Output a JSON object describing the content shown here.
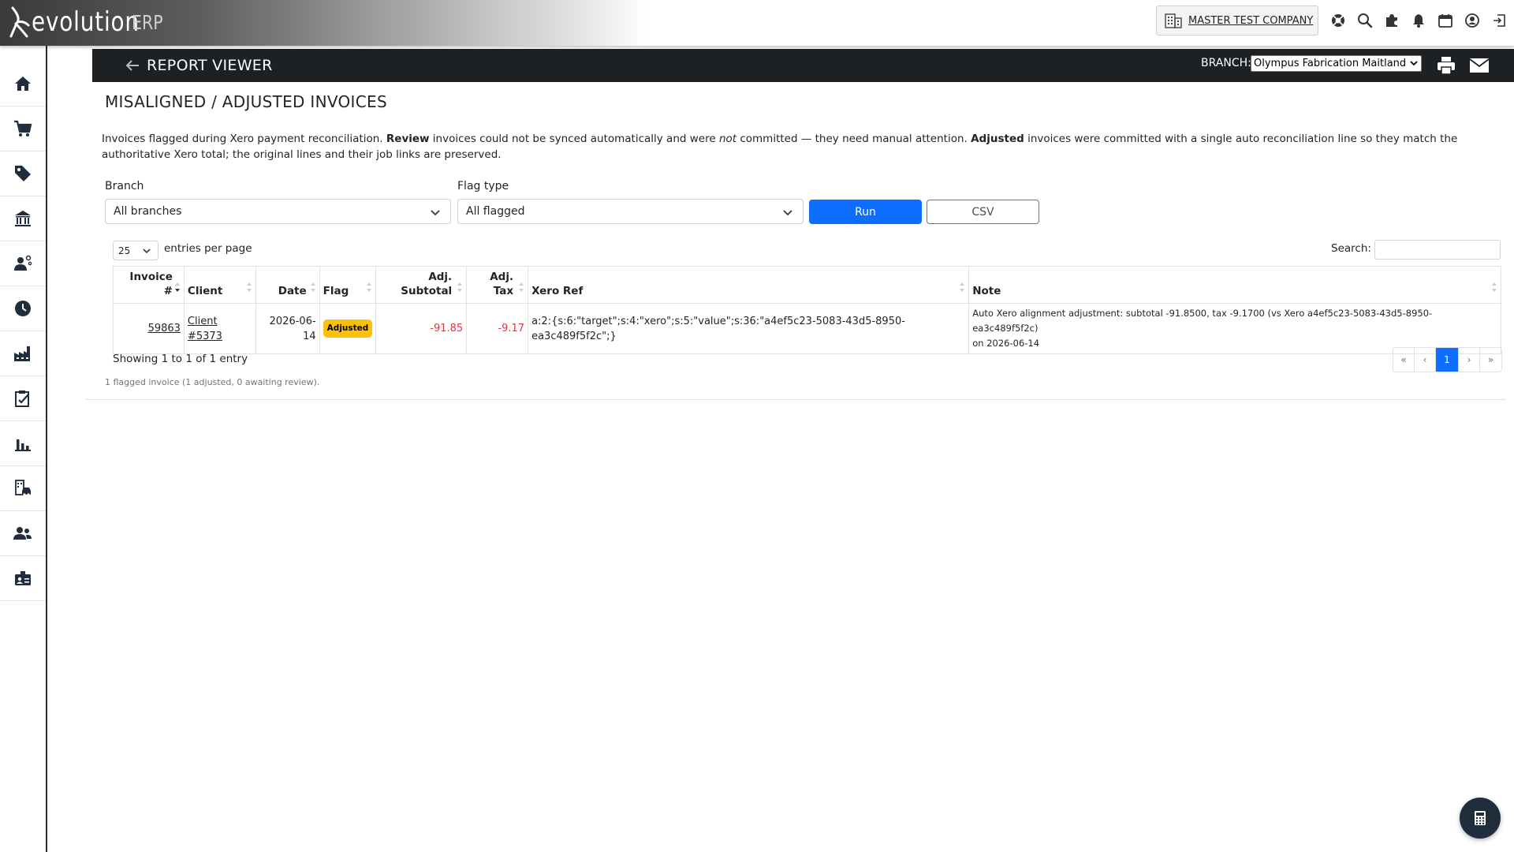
{
  "app": {
    "logo_main": "evolution",
    "logo_suffix": "ERP"
  },
  "topbar": {
    "company_label": "MASTER TEST COMPANY"
  },
  "report_bar": {
    "title": "REPORT VIEWER",
    "branch_label": "BRANCH:",
    "branch_value": "Olympus Fabrication Maitland"
  },
  "page": {
    "title": "MISALIGNED / ADJUSTED INVOICES",
    "desc_1": "Invoices flagged during Xero payment reconciliation. ",
    "desc_review": "Review",
    "desc_2": " invoices could not be synced automatically and were ",
    "desc_not": "not",
    "desc_3": " committed — they need manual attention. ",
    "desc_adjusted": "Adjusted",
    "desc_4": " invoices were committed with a single auto reconciliation line so they match the authoritative Xero total; the original lines and their job links are preserved."
  },
  "filters": {
    "branch_label": "Branch",
    "branch_value": "All branches",
    "flag_label": "Flag type",
    "flag_value": "All flagged",
    "run_label": "Run",
    "csv_label": "CSV"
  },
  "table_controls": {
    "page_length": "25",
    "page_length_label": "entries per page",
    "search_label": "Search:"
  },
  "table": {
    "headers": {
      "invoice_1": "Invoice",
      "invoice_2": "#",
      "client": "Client",
      "date": "Date",
      "flag": "Flag",
      "adj_subtotal_1": "Adj.",
      "adj_subtotal_2": "Subtotal",
      "adj_tax_1": "Adj.",
      "adj_tax_2": "Tax",
      "xero_ref": "Xero Ref",
      "note": "Note"
    },
    "rows": [
      {
        "invoice": "59863",
        "client_1": "Client",
        "client_2": "#5373",
        "date_1": "2026-06-",
        "date_2": "14",
        "flag": "Adjusted",
        "adj_subtotal": "-91.85",
        "adj_tax": "-9.17",
        "xero_ref_1": "a:2:{s:6:\"target\";s:4:\"xero\";s:5:\"value\";s:36:\"a4ef5c23-5083-43d5-8950-",
        "xero_ref_2": "ea3c489f5f2c\";}",
        "note_1": "Auto Xero alignment adjustment: subtotal -91.8500, tax -9.1700 (vs Xero a4ef5c23-5083-43d5-8950-ea3c489f5f2c)",
        "note_2": "on 2026-06-14"
      }
    ]
  },
  "footer": {
    "showing": "Showing 1 to 1 of 1 entry",
    "pager": {
      "first": "«",
      "prev": "‹",
      "current": "1",
      "next": "›",
      "last": "»"
    },
    "summary": "1 flagged invoice (1 adjusted, 0 awaiting review)."
  },
  "colors": {
    "accent": "#0d6efd",
    "badge": "#ffc107",
    "negative": "#dc3545",
    "header_bar": "#1e2124"
  },
  "icons": [
    "building-icon",
    "support-icon",
    "search-icon",
    "puzzle-icon",
    "bell-icon",
    "calendar-icon",
    "user-icon",
    "logout-icon",
    "home-icon",
    "cart-icon",
    "tag-icon",
    "bank-icon",
    "worker-icon",
    "clock-icon",
    "factory-icon",
    "clipboard-check-icon",
    "bar-chart-icon",
    "building-car-icon",
    "people-icon",
    "id-card-icon",
    "back-arrow-icon",
    "print-icon",
    "mail-icon",
    "calculator-icon"
  ]
}
